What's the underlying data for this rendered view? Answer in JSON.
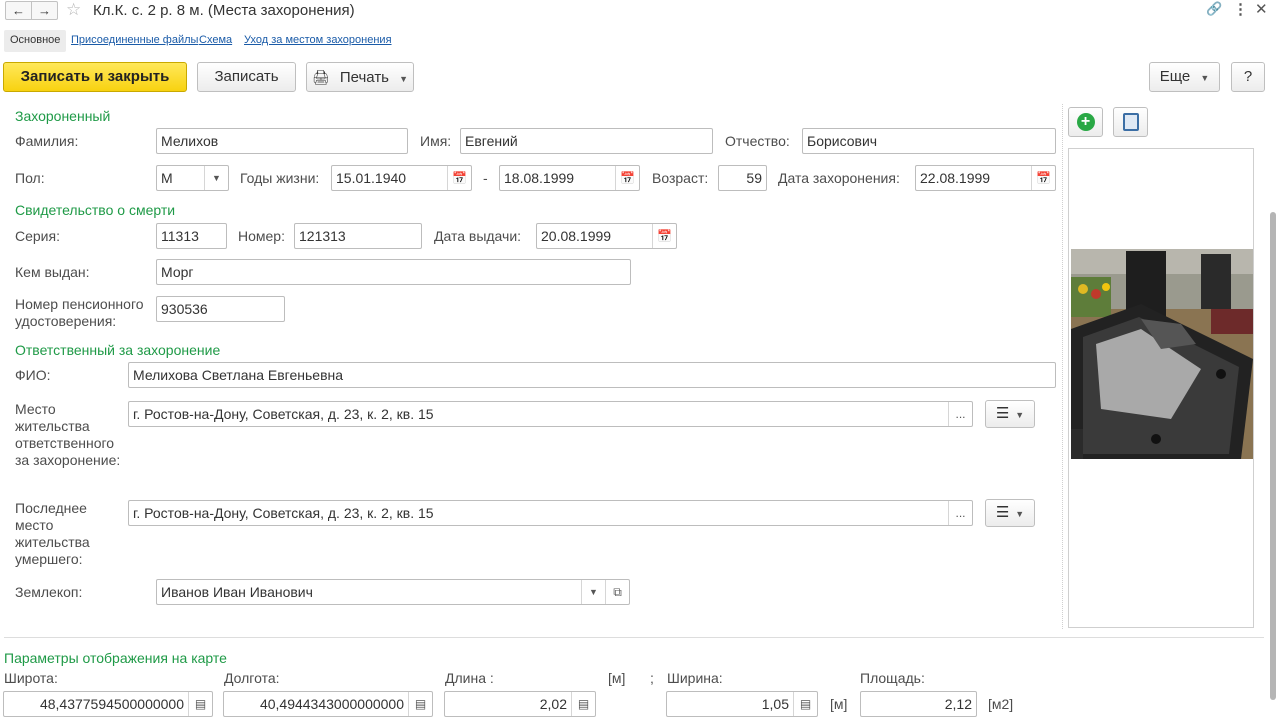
{
  "window": {
    "title": "Кл.К. с. 2 р. 8 м. (Места захоронения)"
  },
  "tabs": [
    {
      "label": "Основное"
    },
    {
      "label": "Присоединенные файлы"
    },
    {
      "label": "Схема"
    },
    {
      "label": "Уход за местом захоронения"
    }
  ],
  "toolbar": {
    "save_close": "Записать и закрыть",
    "save": "Записать",
    "print": "Печать",
    "more": "Еще",
    "help": "?"
  },
  "buried": {
    "group_title": "Захороненный",
    "surname_label": "Фамилия:",
    "surname": "Мелихов",
    "name_label": "Имя:",
    "name": "Евгений",
    "patronymic_label": "Отчество:",
    "patronymic": "Борисович",
    "gender_label": "Пол:",
    "gender": "М",
    "years_label": "Годы жизни:",
    "birth_date": "15.01.1940",
    "dash": "-",
    "death_date": "18.08.1999",
    "age_label": "Возраст:",
    "age": "59",
    "burial_date_label": "Дата захоронения:",
    "burial_date": "22.08.1999"
  },
  "certificate": {
    "group_title": "Свидетельство о смерти",
    "series_label": "Серия:",
    "series": "11313",
    "number_label": "Номер:",
    "number": "121313",
    "issue_date_label": "Дата выдачи:",
    "issue_date": "20.08.1999",
    "issued_by_label": "Кем выдан:",
    "issued_by": "Морг",
    "pension_label": "Номер пенсионного удостоверения:",
    "pension": "930536"
  },
  "responsible": {
    "group_title": "Ответственный за захоронение",
    "fio_label": "ФИО:",
    "fio": "Мелихова Светлана Евгеньевна",
    "residence_label": "Место жительства ответственного за захоронение:",
    "residence": "г. Ростов-на-Дону, Советская, д. 23, к. 2, кв. 15",
    "last_residence_label": "Последнее место жительства умершего:",
    "last_residence": "г. Ростов-на-Дону, Советская, д. 23, к. 2, кв. 15",
    "digger_label": "Землекоп:",
    "digger": "Иванов Иван Иванович",
    "ellipsis": "..."
  },
  "map_params": {
    "group_title": "Параметры отображения на карте",
    "lat_label": "Широта:",
    "lat": "48,4377594500000000",
    "lon_label": "Долгота:",
    "lon": "40,4944343000000000",
    "length_label": "Длина :",
    "length": "2,02",
    "unit_m": "[м]",
    "semicolon": ";",
    "width_label": "Ширина:",
    "width": "1,05",
    "area_label": "Площадь:",
    "area": "2,12",
    "unit_m2": "[м2]"
  },
  "icons": {
    "back": "arrow-left-icon",
    "forward": "arrow-right-icon",
    "favorite": "star-icon",
    "link": "link-icon",
    "menu": "more-vertical-icon",
    "close": "close-icon",
    "print": "printer-icon",
    "calendar": "calendar-icon",
    "add": "plus-circle-icon",
    "edit_image": "edit-image-icon",
    "list": "list-icon",
    "open": "open-icon"
  },
  "colors": {
    "primary_button": "#f8d210",
    "group_title": "#1f9a47",
    "link": "#1a5ba8"
  }
}
